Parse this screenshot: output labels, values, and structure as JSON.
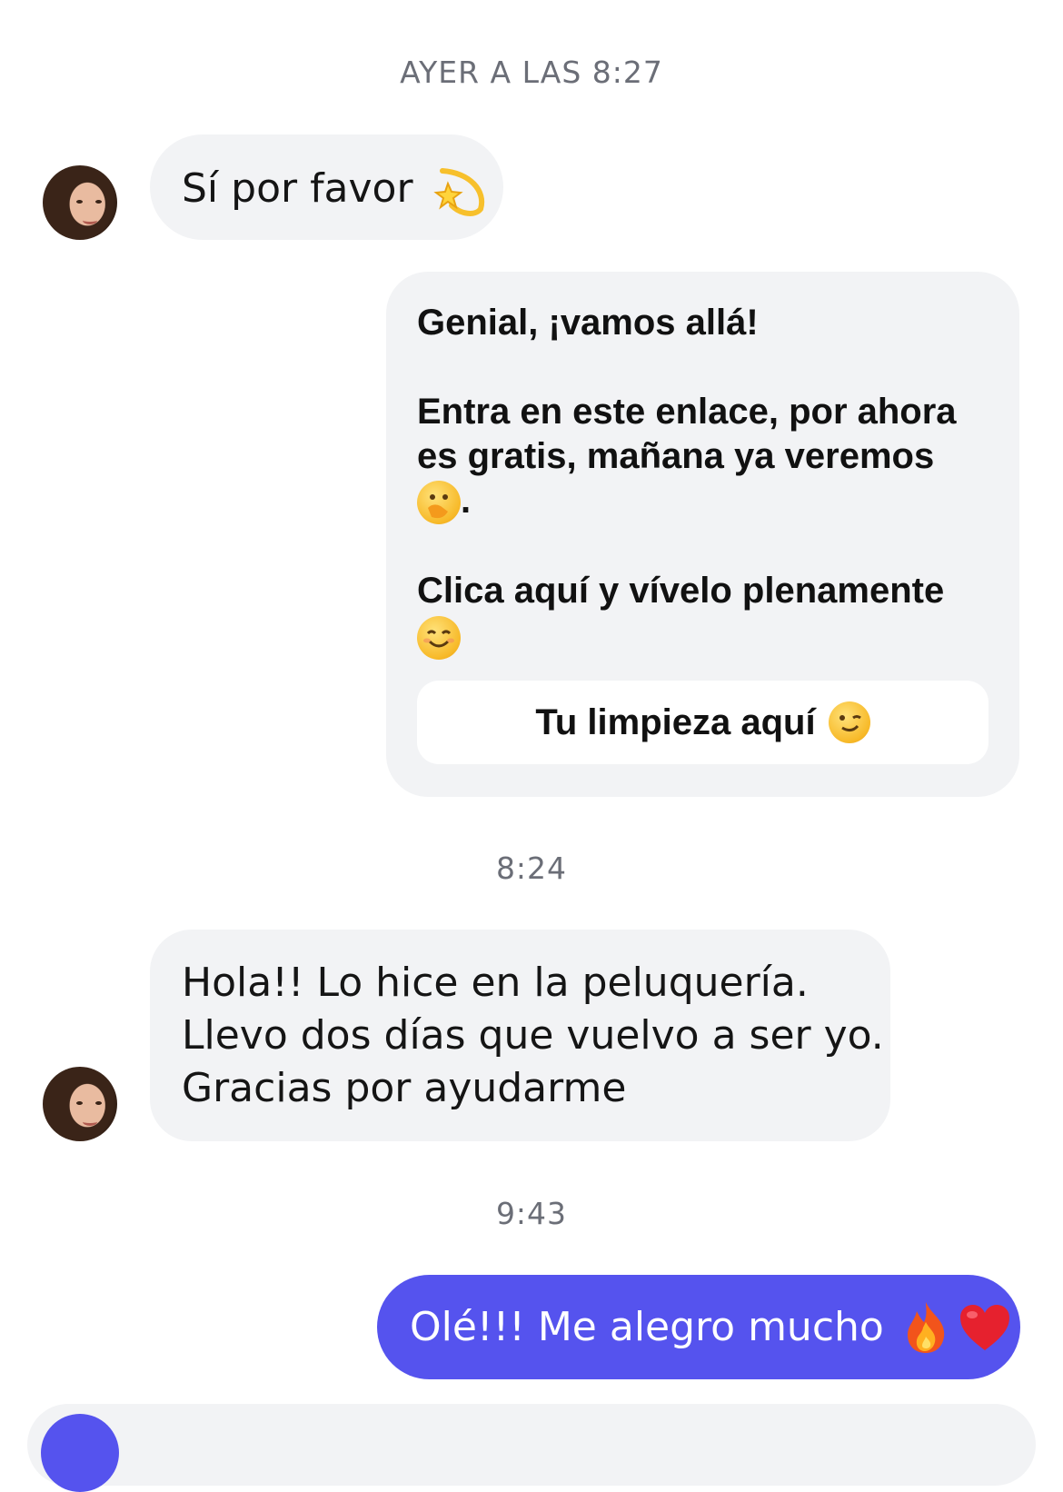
{
  "timestamps": {
    "t1": "AYER A LAS 8:27",
    "t2": "8:24",
    "t3": "9:43"
  },
  "messages": {
    "in1": {
      "text": "Sí por favor",
      "emoji": "dizzy-star-emoji"
    },
    "card": {
      "line1": "Genial, ¡vamos allá!",
      "line2": "Entra en este enlace, por ahora es gratis, mañana ya veremos",
      "line2_suffix": ".",
      "line2_emoji": "hand-over-mouth-emoji",
      "line3": "Clica aquí y vívelo plenamente",
      "line3_emoji": "smiling-face-emoji",
      "button_label": "Tu limpieza aquí",
      "button_emoji": "winking-face-emoji"
    },
    "in2": {
      "line1": "Hola!! Lo hice en la peluquería.",
      "line2": "Llevo dos días que vuelvo a ser yo.",
      "line3": "Gracias por ayudarme"
    },
    "out1": {
      "text": "Olé!!! Me alegro mucho",
      "emoji1": "fire-emoji",
      "emoji2": "red-heart-emoji"
    }
  },
  "colors": {
    "outgoing_bubble": "#5553ee",
    "incoming_bubble": "#f2f3f5",
    "timestamp": "#6b6e77"
  }
}
